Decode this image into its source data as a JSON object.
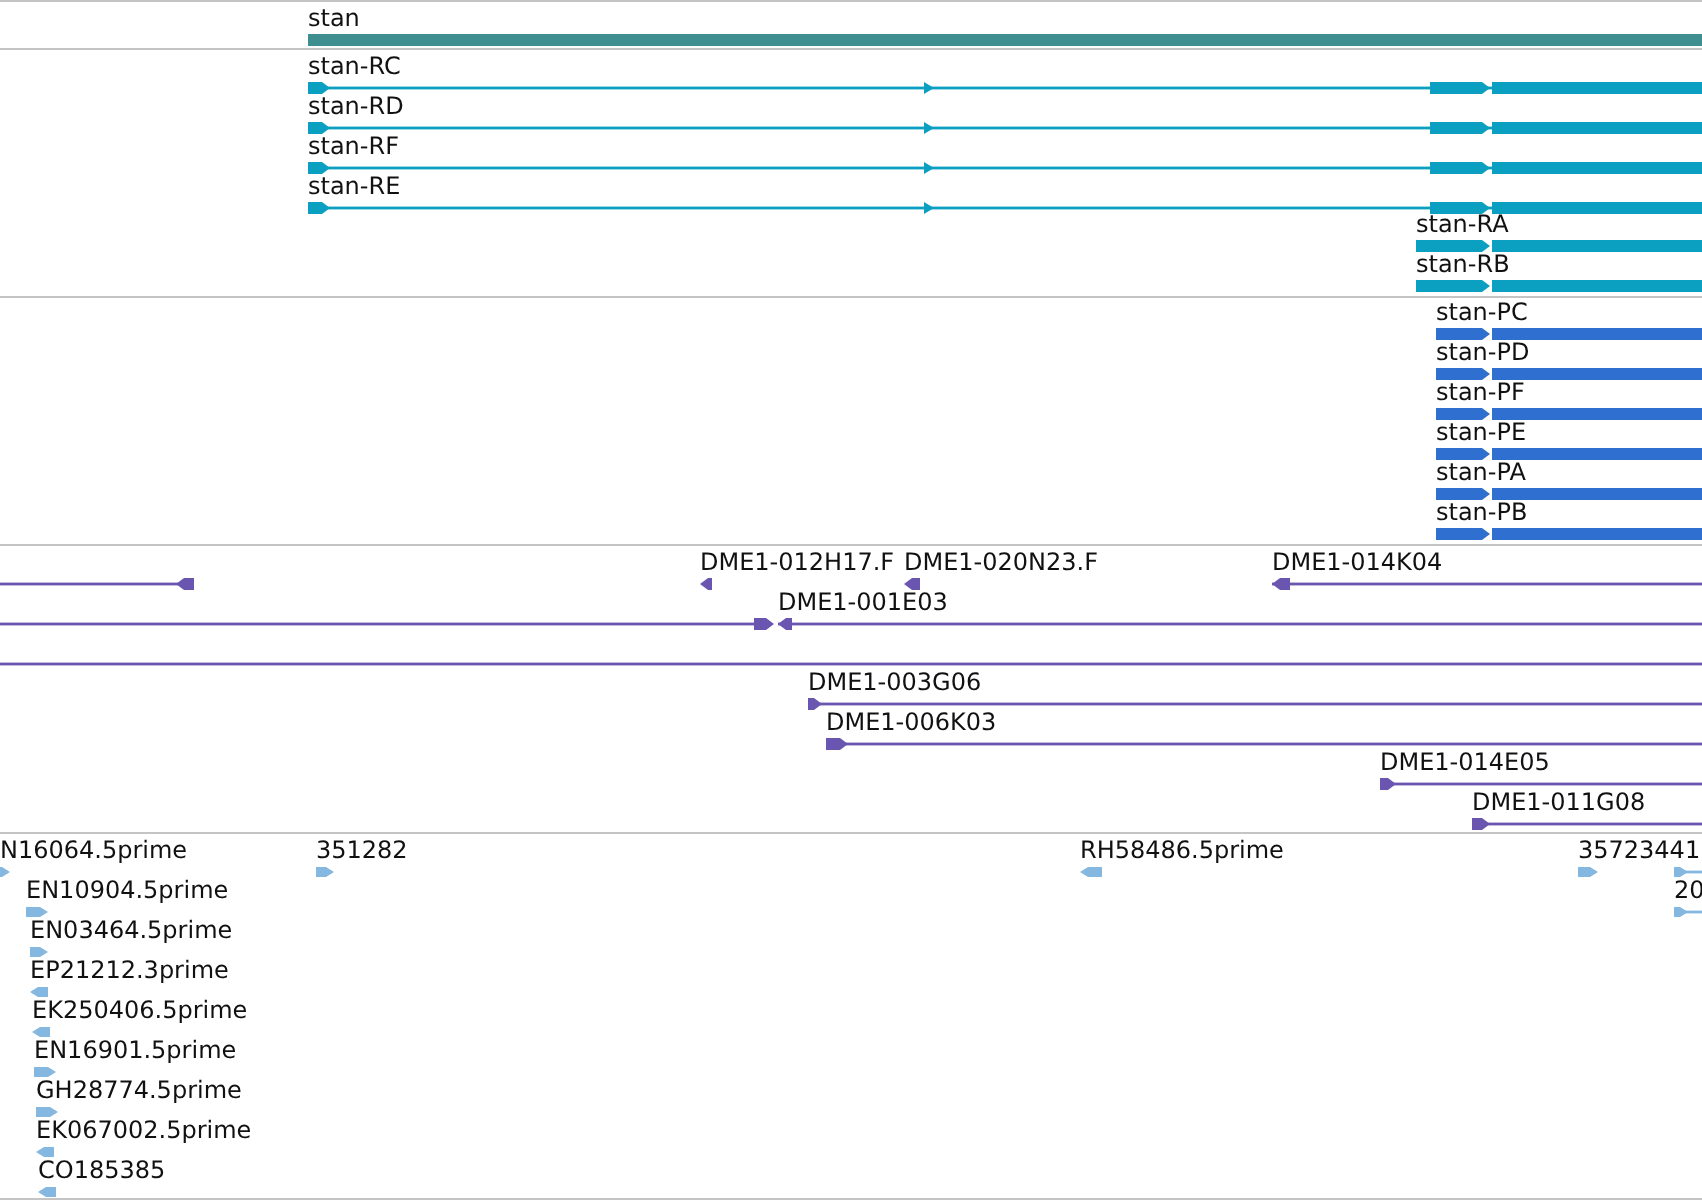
{
  "tracks": [
    {
      "kind": "gene",
      "features": [
        {
          "label": "stan"
        }
      ]
    },
    {
      "kind": "transcript",
      "features": [
        {
          "label": "stan-RC"
        },
        {
          "label": "stan-RD"
        },
        {
          "label": "stan-RF"
        },
        {
          "label": "stan-RE"
        },
        {
          "label": "stan-RA"
        },
        {
          "label": "stan-RB"
        }
      ]
    },
    {
      "kind": "protein",
      "features": [
        {
          "label": "stan-PC"
        },
        {
          "label": "stan-PD"
        },
        {
          "label": "stan-PF"
        },
        {
          "label": "stan-PE"
        },
        {
          "label": "stan-PA"
        },
        {
          "label": "stan-PB"
        }
      ]
    },
    {
      "kind": "clone",
      "features": [
        {
          "kind": "arrow",
          "reverse": true
        },
        {
          "kind": "arrow",
          "label": "DME1-012H17.F",
          "reverse": true
        },
        {
          "kind": "arrow",
          "label": "DME1-020N23.F",
          "reverse": true
        },
        {
          "kind": "arrow",
          "label": "DME1-014K04",
          "reverse": true
        },
        {
          "kind": "arrow",
          "reverse": false
        },
        {
          "kind": "arrow",
          "label": "DME1-001E03",
          "reverse": true
        },
        {
          "kind": "line"
        },
        {
          "kind": "arrow",
          "label": "DME1-003G06",
          "reverse": false
        },
        {
          "kind": "arrow",
          "label": "DME1-006K03",
          "reverse": false
        },
        {
          "kind": "arrow",
          "label": "DME1-014E05",
          "reverse": false
        },
        {
          "kind": "arrow",
          "label": "DME1-011G08",
          "reverse": false
        }
      ]
    },
    {
      "kind": "est",
      "features": [
        {
          "label": "N16064.5prime",
          "reverse": false
        },
        {
          "label": "351282",
          "reverse": false
        },
        {
          "label": "RH58486.5prime",
          "reverse": true
        },
        {
          "label": "35723441",
          "reverse": false
        },
        {
          "reverse": false
        },
        {
          "label": "EN10904.5prime",
          "reverse": false
        },
        {
          "label": "20",
          "reverse": false
        },
        {
          "label": "EN03464.5prime",
          "reverse": false
        },
        {
          "label": "EP21212.3prime",
          "reverse": true
        },
        {
          "label": "EK250406.5prime",
          "reverse": true
        },
        {
          "label": "EN16901.5prime",
          "reverse": false
        },
        {
          "label": "GH28774.5prime",
          "reverse": false
        },
        {
          "label": "EK067002.5prime",
          "reverse": true
        },
        {
          "label": "CO185385",
          "reverse": true
        }
      ]
    }
  ]
}
